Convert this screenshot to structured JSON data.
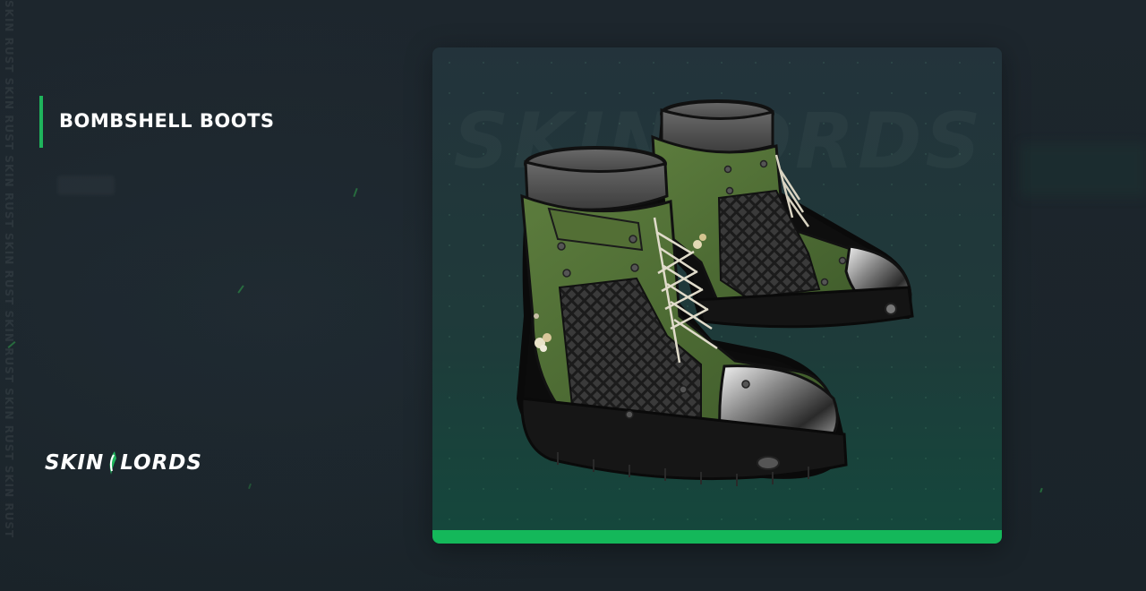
{
  "title": "BOMBSHELL BOOTS",
  "side_watermark": "SKIN RUST SKIN RUST SKIN RUST SKIN RUST SKIN RUST SKIN RUST SKIN RUST",
  "logo": {
    "left": "SKIN",
    "right": "LORDS"
  },
  "card": {
    "watermark": "SKINLORDS",
    "accent_color": "#14b85a",
    "image": "bombshell-boots"
  },
  "colors": {
    "background": "#1c252c",
    "accent": "#1fb45c",
    "boot_green": "#4c6b33",
    "boot_black": "#1a1a1a"
  }
}
